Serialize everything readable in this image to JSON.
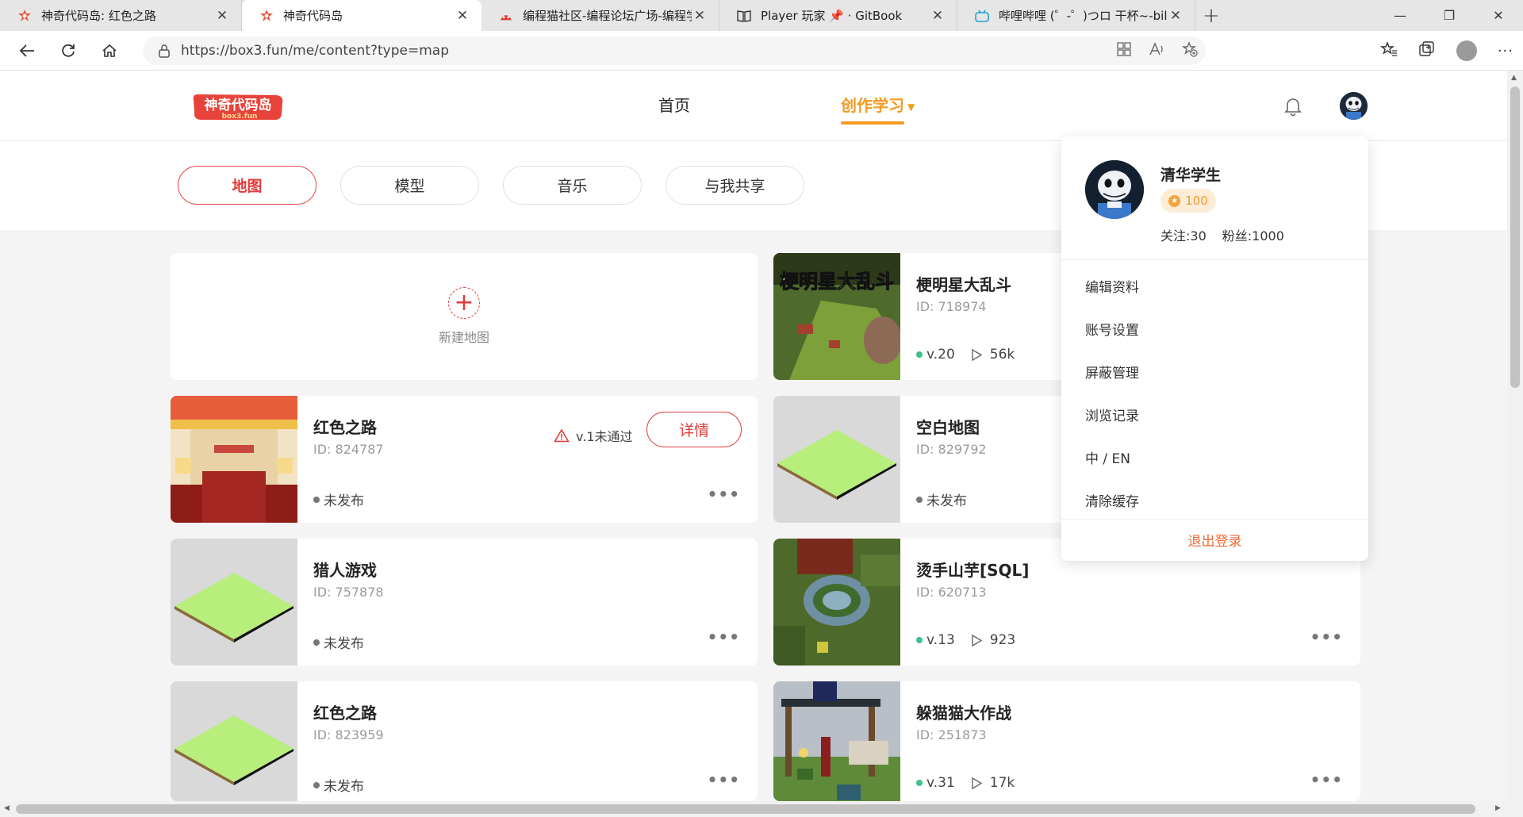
{
  "browser": {
    "tabs": [
      {
        "title": "神奇代码岛: 红色之路",
        "favicon": "box3-icon",
        "active": false
      },
      {
        "title": "神奇代码岛",
        "favicon": "box3-icon",
        "active": true
      },
      {
        "title": "编程猫社区-编程论坛广场-编程学",
        "favicon": "codemao-icon",
        "active": false
      },
      {
        "title": "Player 玩家 📌 · GitBook",
        "favicon": "book-icon",
        "active": false
      },
      {
        "title": "哔哩哔哩 (゜-゜)つロ 干杯~-bilibili",
        "favicon": "bilibili-icon",
        "active": false
      }
    ],
    "url": "https://box3.fun/me/content?type=map"
  },
  "header": {
    "logo_text": "神奇代码岛",
    "logo_sub": "box3.fun",
    "nav_home": "首页",
    "nav_create": "创作学习"
  },
  "subtabs": [
    "地图",
    "模型",
    "音乐",
    "与我共享"
  ],
  "new_map_label": "新建地图",
  "cards": [
    {
      "title": "梗明星大乱斗",
      "id": "ID: 718974",
      "version": "v.20",
      "plays": "56k",
      "published": true
    },
    {
      "title": "红色之路",
      "id": "ID: 824787",
      "status": "未发布",
      "warning": "v.1未通过",
      "detail": "详情",
      "published": false
    },
    {
      "title": "空白地图",
      "id": "ID: 829792",
      "status": "未发布",
      "published": false
    },
    {
      "title": "猎人游戏",
      "id": "ID: 757878",
      "status": "未发布",
      "published": false
    },
    {
      "title": "烫手山芋[SQL]",
      "id": "ID: 620713",
      "version": "v.13",
      "plays": "923",
      "published": true
    },
    {
      "title": "红色之路",
      "id": "ID: 823959",
      "status": "未发布",
      "published": false
    },
    {
      "title": "躲猫猫大作战",
      "id": "ID: 251873",
      "version": "v.31",
      "plays": "17k",
      "published": true
    }
  ],
  "thumb_overlay_text": "梗明星大乱斗",
  "more_glyph": "•••",
  "dropdown": {
    "name": "清华学生",
    "coins": "100",
    "follow": "关注:30",
    "fans": "粉丝:1000",
    "items": [
      "编辑资料",
      "账号设置",
      "屏蔽管理",
      "浏览记录",
      "中 / EN",
      "清除缓存"
    ],
    "logout": "退出登录"
  },
  "colors": {
    "accent_red": "#e43a3a",
    "accent_orange": "#f39a21",
    "published_green": "#3ec18a",
    "unpublished_gray": "#777777"
  }
}
